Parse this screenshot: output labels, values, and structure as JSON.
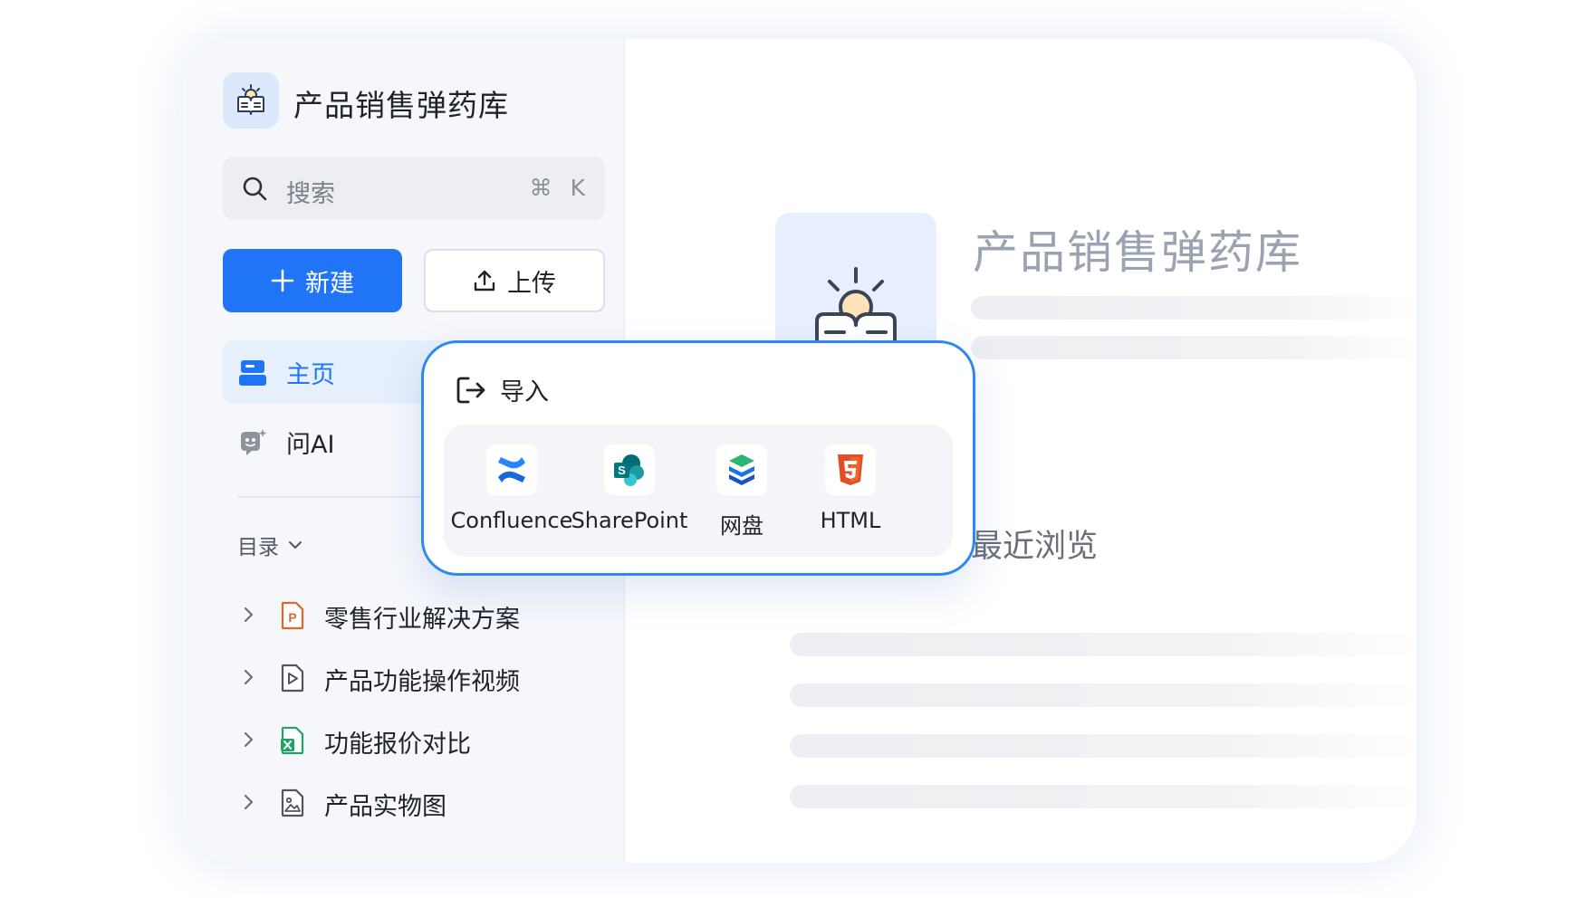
{
  "sidebar": {
    "brand_title": "产品销售弹药库",
    "search": {
      "placeholder": "搜索",
      "shortcut": "⌘ K"
    },
    "buttons": {
      "new_label": "新建",
      "upload_label": "上传"
    },
    "nav": [
      {
        "label": "主页",
        "active": true
      },
      {
        "label": "问AI",
        "active": false
      }
    ],
    "toc_title": "目录",
    "tree": [
      {
        "label": "零售行业解决方案",
        "icon": "ppt-file-icon"
      },
      {
        "label": "产品功能操作视频",
        "icon": "video-file-icon"
      },
      {
        "label": "功能报价对比",
        "icon": "excel-file-icon"
      },
      {
        "label": "产品实物图",
        "icon": "image-file-icon"
      }
    ]
  },
  "main": {
    "doc_title": "产品销售弹药库",
    "recent_title": "最近浏览"
  },
  "import_popup": {
    "title": "导入",
    "options": [
      {
        "label": "Confluence",
        "icon": "confluence-icon"
      },
      {
        "label": "SharePoint",
        "icon": "sharepoint-icon"
      },
      {
        "label": "网盘",
        "icon": "netdisk-icon"
      },
      {
        "label": "HTML",
        "icon": "html5-icon"
      }
    ]
  },
  "colors": {
    "accent": "#1f75f5",
    "popup_border": "#2d88f0",
    "sidebar_bg": "#f5f7fb"
  }
}
